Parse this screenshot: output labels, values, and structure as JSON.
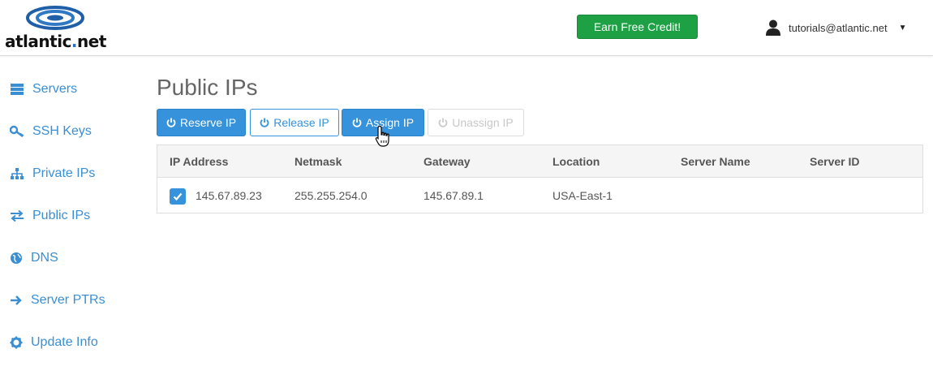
{
  "header": {
    "logo_text_main": "atlantic",
    "logo_text_dot": ".",
    "logo_text_tld": "net",
    "earn_credit_label": "Earn Free Credit!",
    "account_email": "tutorials@atlantic.net",
    "account_caret": "▼"
  },
  "sidebar": {
    "items": [
      {
        "label": "Servers",
        "icon": "server-icon"
      },
      {
        "label": "SSH Keys",
        "icon": "key-icon"
      },
      {
        "label": "Private IPs",
        "icon": "sitemap-icon"
      },
      {
        "label": "Public IPs",
        "icon": "exchange-icon"
      },
      {
        "label": "DNS",
        "icon": "globe-icon"
      },
      {
        "label": "Server PTRs",
        "icon": "arrow-right-icon"
      },
      {
        "label": "Update Info",
        "icon": "gear-icon"
      }
    ]
  },
  "main": {
    "title": "Public IPs",
    "actions": {
      "reserve": "Reserve IP",
      "release": "Release IP",
      "assign": "Assign IP",
      "unassign": "Unassign IP"
    },
    "table": {
      "columns": [
        "IP Address",
        "Netmask",
        "Gateway",
        "Location",
        "Server Name",
        "Server ID"
      ],
      "rows": [
        {
          "checked": true,
          "ip_address": "145.67.89.23",
          "netmask": "255.255.254.0",
          "gateway": "145.67.89.1",
          "location": "USA-East-1",
          "server_name": "",
          "server_id": ""
        }
      ]
    }
  },
  "colors": {
    "brand_blue": "#3592db",
    "link_blue": "#3a8fd4",
    "earn_green": "#1ea045",
    "disabled_gray": "#c8c8c8"
  }
}
